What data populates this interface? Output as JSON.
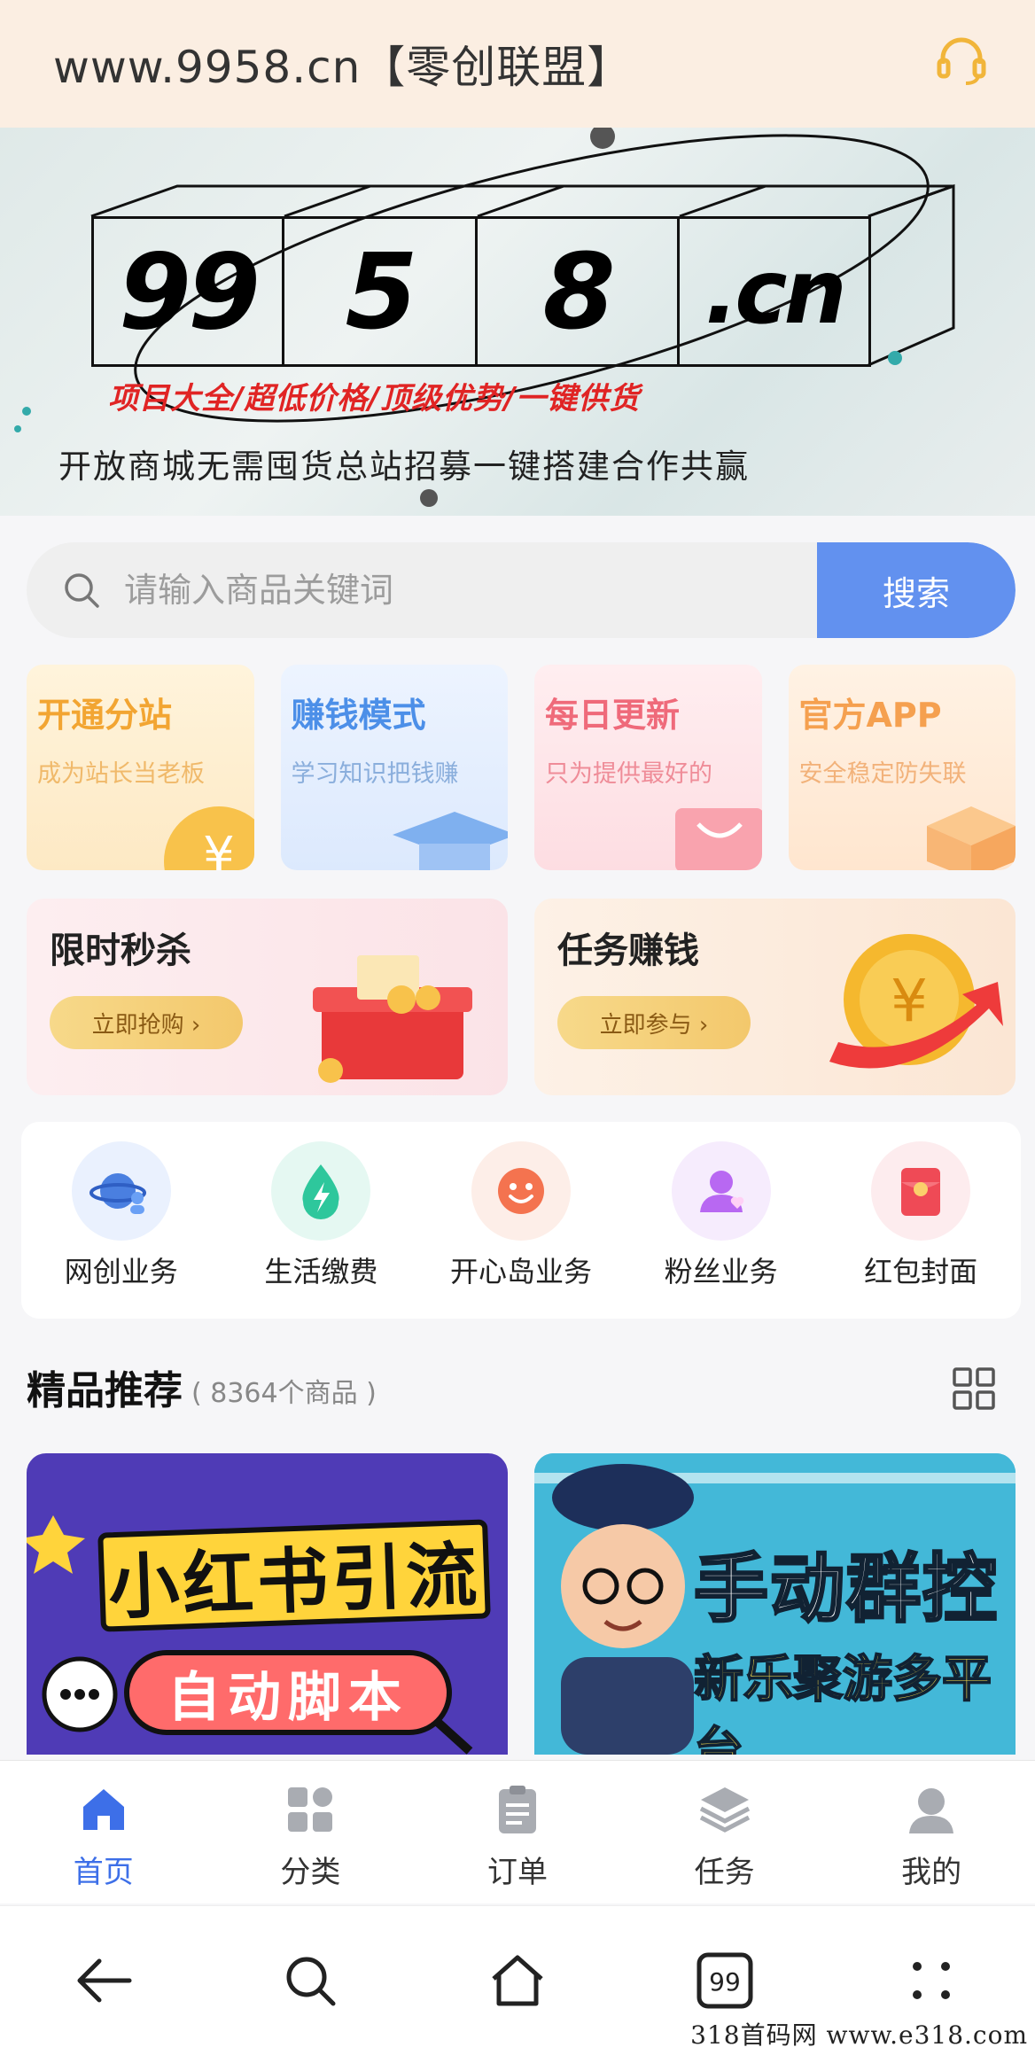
{
  "header": {
    "title": "www.9958.cn【零创联盟】",
    "support_icon": "headset-icon"
  },
  "banner": {
    "boxes": [
      "99",
      "5",
      "8",
      ".cn"
    ],
    "slogan": "项目大全/超低价格/顶级优势/一键供货",
    "subline": "开放商城无需囤货总站招募一键搭建合作共赢"
  },
  "search": {
    "placeholder": "请输入商品关键词",
    "button": "搜索"
  },
  "features": [
    {
      "title": "开通分站",
      "subtitle": "成为站长当老板"
    },
    {
      "title": "赚钱模式",
      "subtitle": "学习知识把钱赚"
    },
    {
      "title": "每日更新",
      "subtitle": "只为提供最好的"
    },
    {
      "title": "官方APP",
      "subtitle": "安全稳定防失联"
    }
  ],
  "promos": [
    {
      "title": "限时秒杀",
      "button": "立即抢购 ›"
    },
    {
      "title": "任务赚钱",
      "button": "立即参与 ›"
    }
  ],
  "categories": [
    {
      "label": "网创业务",
      "icon": "planet-user-icon"
    },
    {
      "label": "生活缴费",
      "icon": "water-bolt-icon"
    },
    {
      "label": "开心岛业务",
      "icon": "smiley-icon"
    },
    {
      "label": "粉丝业务",
      "icon": "person-icon"
    },
    {
      "label": "红包封面",
      "icon": "red-envelope-icon"
    }
  ],
  "recommend": {
    "title": "精品推荐",
    "count": "( 8364个商品 )"
  },
  "products": [
    {
      "line1": "小红书引流",
      "line2": "自动脚本"
    },
    {
      "line1": "手动群控",
      "line2": "新乐聚游多平台"
    }
  ],
  "tabs": [
    {
      "label": "首页",
      "icon": "home-icon",
      "active": true
    },
    {
      "label": "分类",
      "icon": "grid-icon",
      "active": false
    },
    {
      "label": "订单",
      "icon": "clipboard-icon",
      "active": false
    },
    {
      "label": "任务",
      "icon": "layers-icon",
      "active": false
    },
    {
      "label": "我的",
      "icon": "user-icon",
      "active": false
    }
  ],
  "system_nav": {
    "tab_count": "99"
  },
  "watermark": "318首码网  www.e318.com",
  "colors": {
    "accent": "#6291ef",
    "tab_active": "#3d6fe8",
    "header_bg": "#fbeee2"
  }
}
